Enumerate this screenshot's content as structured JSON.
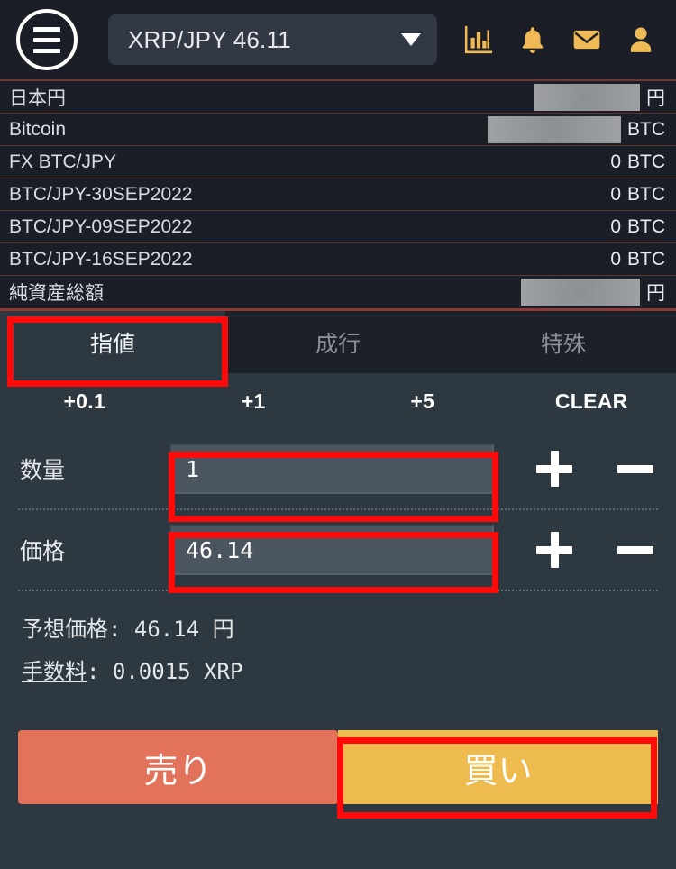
{
  "header": {
    "menu_icon": "hamburger-menu-icon",
    "pair_label": "XRP/JPY 46.11",
    "caret_icon": "chevron-down-icon",
    "icons": [
      {
        "name": "bar-chart-icon",
        "color": "#EFBA55"
      },
      {
        "name": "bell-icon",
        "color": "#EFBA55"
      },
      {
        "name": "envelope-icon",
        "color": "#EFBA55"
      },
      {
        "name": "user-icon",
        "color": "#EFBA55"
      }
    ]
  },
  "assets": {
    "rows": [
      {
        "name": "日本円",
        "value": "",
        "masked": true,
        "unit": "円"
      },
      {
        "name": "Bitcoin",
        "value": "",
        "masked": true,
        "unit": "BTC"
      },
      {
        "name": "FX BTC/JPY",
        "value": "0",
        "masked": false,
        "unit": "BTC"
      },
      {
        "name": "BTC/JPY-30SEP2022",
        "value": "0",
        "masked": false,
        "unit": "BTC"
      },
      {
        "name": "BTC/JPY-09SEP2022",
        "value": "0",
        "masked": false,
        "unit": "BTC"
      },
      {
        "name": "BTC/JPY-16SEP2022",
        "value": "0",
        "masked": false,
        "unit": "BTC"
      },
      {
        "name": "純資産総額",
        "value": "",
        "masked": true,
        "unit": "円"
      }
    ]
  },
  "order_tabs": [
    {
      "label": "指値",
      "active": true
    },
    {
      "label": "成行",
      "active": false
    },
    {
      "label": "特殊",
      "active": false
    }
  ],
  "quick_buttons": [
    {
      "label": "+0.1"
    },
    {
      "label": "+1"
    },
    {
      "label": "+5"
    },
    {
      "label": "CLEAR"
    }
  ],
  "fields": {
    "quantity": {
      "label": "数量",
      "value": "1",
      "placeholder": "",
      "plus_label": "+",
      "minus_label": "−"
    },
    "price": {
      "label": "価格",
      "value": "46.14",
      "placeholder": "",
      "plus_label": "+",
      "minus_label": "−"
    }
  },
  "info": {
    "expected_price_key": "予想価格",
    "expected_price_value": ": 46.14  円",
    "fee_key": "手数料",
    "fee_value": ": 0.0015  XRP"
  },
  "actions": {
    "sell_label": "売り",
    "buy_label": "買い",
    "sell_color": "#E2735A",
    "buy_color": "#EEBC4E"
  },
  "annotations": {
    "highlight_color": "#FF0A0A",
    "boxes": [
      "order-tab-limit",
      "quantity-input",
      "price-input",
      "buy-button"
    ]
  }
}
